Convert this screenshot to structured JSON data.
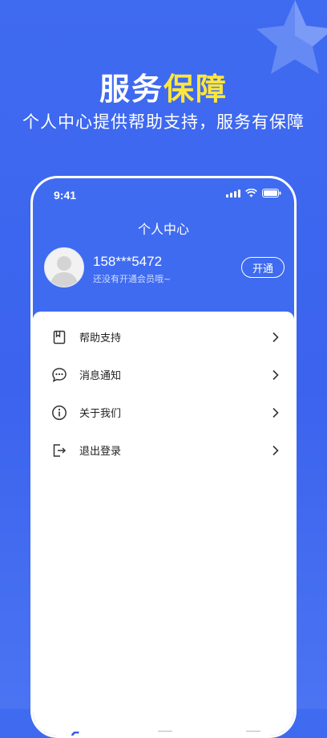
{
  "promo": {
    "title_part1": "服务",
    "title_part2": "保障",
    "subtitle": "个人中心提供帮助支持，服务有保障"
  },
  "status_bar": {
    "time": "9:41"
  },
  "page": {
    "title": "个人中心"
  },
  "profile": {
    "phone": "158***5472",
    "member_status": "还没有开通会员哦~",
    "open_button_label": "开通"
  },
  "menu": {
    "items": [
      {
        "label": "帮助支持",
        "icon": "help-book-icon"
      },
      {
        "label": "消息通知",
        "icon": "message-bubble-icon"
      },
      {
        "label": "关于我们",
        "icon": "info-icon"
      },
      {
        "label": "退出登录",
        "icon": "logout-icon"
      }
    ]
  },
  "colors": {
    "background": "#3f6bf0",
    "highlight": "#ffe73a",
    "card": "#ffffff",
    "text": "#222222"
  }
}
